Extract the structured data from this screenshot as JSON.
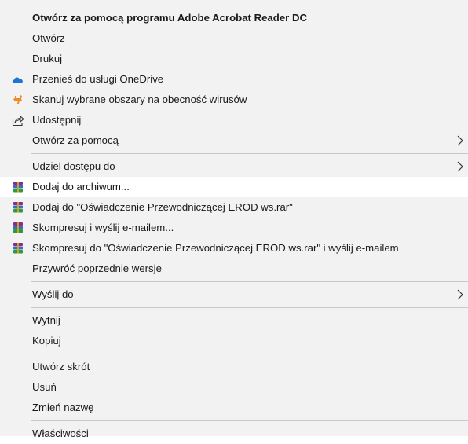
{
  "menu": {
    "items": [
      {
        "label": "Otwórz za pomocą programu Adobe Acrobat Reader DC"
      },
      {
        "label": "Otwórz"
      },
      {
        "label": "Drukuj"
      },
      {
        "label": "Przenieś do usługi OneDrive",
        "icon": "onedrive-icon"
      },
      {
        "label": "Skanuj wybrane obszary na obecność wirusów",
        "icon": "antivirus-icon"
      },
      {
        "label": "Udostępnij",
        "icon": "share-icon"
      },
      {
        "label": "Otwórz za pomocą",
        "submenu": true
      },
      {
        "label": "Udziel dostępu do",
        "submenu": true
      },
      {
        "label": "Dodaj do archiwum...",
        "icon": "winrar-icon",
        "highlighted": true
      },
      {
        "label": "Dodaj do \"Oświadczenie Przewodniczącej EROD ws.rar\"",
        "icon": "winrar-icon"
      },
      {
        "label": "Skompresuj i wyślij e-mailem...",
        "icon": "winrar-icon"
      },
      {
        "label": "Skompresuj do \"Oświadczenie Przewodniczącej EROD ws.rar\" i wyślij e-mailem",
        "icon": "winrar-icon"
      },
      {
        "label": "Przywróć poprzednie wersje"
      },
      {
        "label": "Wyślij do",
        "submenu": true
      },
      {
        "label": "Wytnij"
      },
      {
        "label": "Kopiuj"
      },
      {
        "label": "Utwórz skrót"
      },
      {
        "label": "Usuń"
      },
      {
        "label": "Zmień nazwę"
      },
      {
        "label": "Właściwości"
      }
    ]
  },
  "colors": {
    "menu_background": "#f2f2f2",
    "highlight_background": "#ffffff",
    "separator": "#c9c9c9",
    "onedrive_blue": "#1d74d4",
    "antivirus_orange": "#f08a24"
  }
}
